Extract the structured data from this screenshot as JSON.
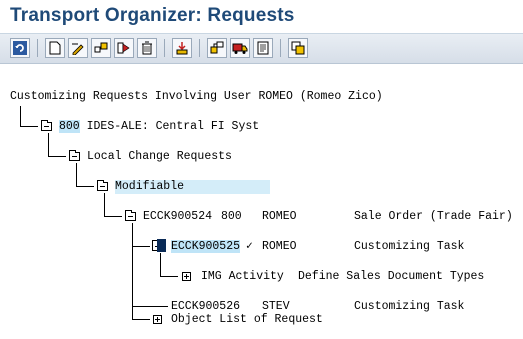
{
  "window": {
    "title": "Transport Organizer: Requests"
  },
  "toolbar": {
    "buttons": [
      "refresh-icon",
      "new-icon",
      "change-icon",
      "display-icon",
      "release-icon",
      "delete-icon",
      "import-icon",
      "tree-expand-icon",
      "truck-icon",
      "protocol-icon",
      "config-icon"
    ]
  },
  "tree": {
    "root": "Customizing Requests Involving User ROMEO (Romeo Zico)",
    "client_num": "800",
    "client_text": " IDES-ALE: Central FI Syst",
    "local_change": "Local Change Requests",
    "modifiable": "Modifiable",
    "request": {
      "id": "ECCK900524",
      "client": "800",
      "owner": "ROMEO",
      "desc": "Sale Order (Trade Fair)"
    },
    "task1": {
      "id": "ECCK900525",
      "check": "✓",
      "owner": "ROMEO",
      "desc": "Customizing Task"
    },
    "img": {
      "label": "IMG Activity",
      "desc": "Define Sales Document Types"
    },
    "task2": {
      "id": "ECCK900526",
      "owner": "STEV",
      "desc": "Customizing Task"
    },
    "object_list": "Object List of Request"
  },
  "colors": {
    "title": "#1f4a78",
    "highlight": "#bfe4f7",
    "toolbar_bg": "#dfe6ee"
  }
}
